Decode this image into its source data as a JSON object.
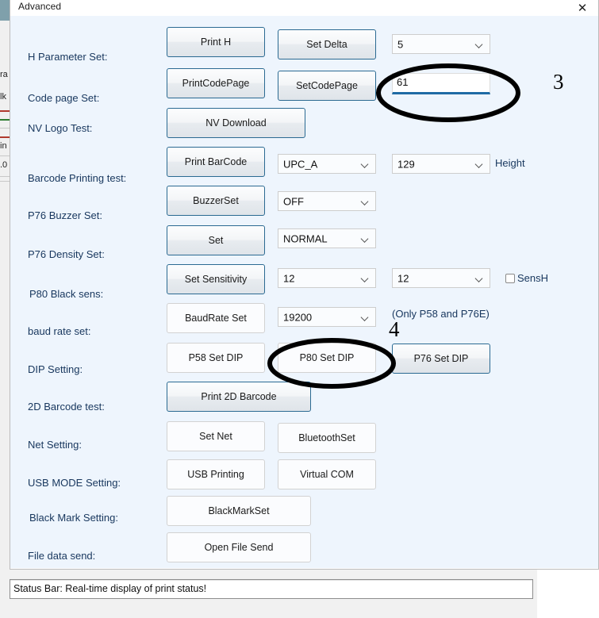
{
  "window": {
    "title": "Advanced",
    "close_icon": "close-icon"
  },
  "background_window": {
    "fragments": [
      "ra",
      "lk",
      "in",
      ".0"
    ]
  },
  "rows": [
    {
      "label": "H Parameter Set:",
      "buttons": [
        "Print H",
        "Set Delta"
      ],
      "combo": "5"
    },
    {
      "label": "Code page Set:",
      "buttons": [
        "PrintCodePage",
        "SetCodePage"
      ],
      "input": "61"
    },
    {
      "label": "NV Logo Test:",
      "buttons": [
        "NV Download"
      ]
    },
    {
      "label": "Barcode Printing test:",
      "buttons": [
        "Print BarCode"
      ],
      "combo1": "UPC_A",
      "combo2": "129",
      "suffix": "Height"
    },
    {
      "label": "P76 Buzzer Set:",
      "buttons": [
        "BuzzerSet"
      ],
      "combo1": "OFF"
    },
    {
      "label": "P76 Density Set:",
      "buttons": [
        "Set"
      ],
      "combo1": "NORMAL"
    },
    {
      "label": "P80 Black sens:",
      "buttons": [
        "Set Sensitivity"
      ],
      "combo1": "12",
      "combo2": "12",
      "checkbox": "SensH"
    },
    {
      "label": "baud rate set:",
      "buttons": [
        "BaudRate Set"
      ],
      "combo1": "19200",
      "note": "(Only P58 and P76E)"
    },
    {
      "label": "DIP Setting:",
      "buttons": [
        "P58 Set DIP",
        "P80 Set DIP",
        "P76 Set DIP"
      ]
    },
    {
      "label": "2D Barcode test:",
      "buttons": [
        "Print 2D Barcode"
      ]
    },
    {
      "label": "Net Setting:",
      "buttons": [
        "Set Net",
        "BluetoothSet"
      ]
    },
    {
      "label": "USB MODE Setting:",
      "buttons": [
        "USB Printing",
        "Virtual COM"
      ]
    },
    {
      "label": "Black Mark Setting:",
      "buttons": [
        "BlackMarkSet"
      ]
    },
    {
      "label": "File data send:",
      "buttons": [
        "Open File Send"
      ]
    }
  ],
  "annotations": {
    "num3": "3",
    "num4": "4"
  },
  "status_bar": {
    "text": "Status Bar: Real-time display of print status!"
  },
  "colors": {
    "client_bg": "#eef5fd",
    "label_text": "#17365d",
    "button_border_blue": "#2b6a92",
    "input_underline": "#1f6ba5",
    "annotation": "#000000"
  }
}
